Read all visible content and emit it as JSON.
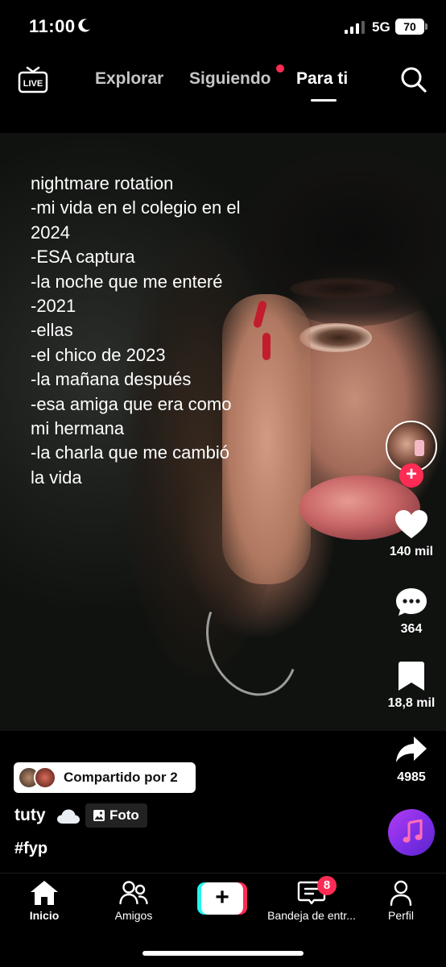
{
  "status_bar": {
    "time": "11:00",
    "network": "5G",
    "battery": "70"
  },
  "top_nav": {
    "live_label": "LIVE",
    "tabs": [
      {
        "label": "Explorar",
        "active": false
      },
      {
        "label": "Siguiendo",
        "active": false,
        "has_dot": true
      },
      {
        "label": "Para ti",
        "active": true
      }
    ]
  },
  "post": {
    "caption": "nightmare rotation\n-mi vida en el colegio en el\n2024\n-ESA captura\n-la noche que me enteré\n-2021\n-ellas\n-el chico de 2023\n-la mañana después\n-esa amiga que era como\nmi hermana\n-la charla que me cambió\nla vida",
    "shared_label": "Compartido por 2",
    "username": "tuty",
    "type_label": "Foto",
    "hashtag": "#fyp"
  },
  "actions": {
    "follow": "+",
    "likes": "140 mil",
    "comments": "364",
    "saves": "18,8 mil",
    "shares": "4985"
  },
  "bottom_nav": {
    "items": [
      {
        "label": "Inicio",
        "icon": "home-icon",
        "active": true
      },
      {
        "label": "Amigos",
        "icon": "friends-icon",
        "active": false
      },
      {
        "label": "+",
        "icon": "create-icon",
        "active": false
      },
      {
        "label": "Bandeja de entr...",
        "icon": "inbox-icon",
        "active": false,
        "badge": "8"
      },
      {
        "label": "Perfil",
        "icon": "profile-icon",
        "active": false
      }
    ]
  },
  "colors": {
    "accent": "#fe2c55",
    "cyan": "#25f4ee",
    "music_disc": "#8a34ea"
  }
}
